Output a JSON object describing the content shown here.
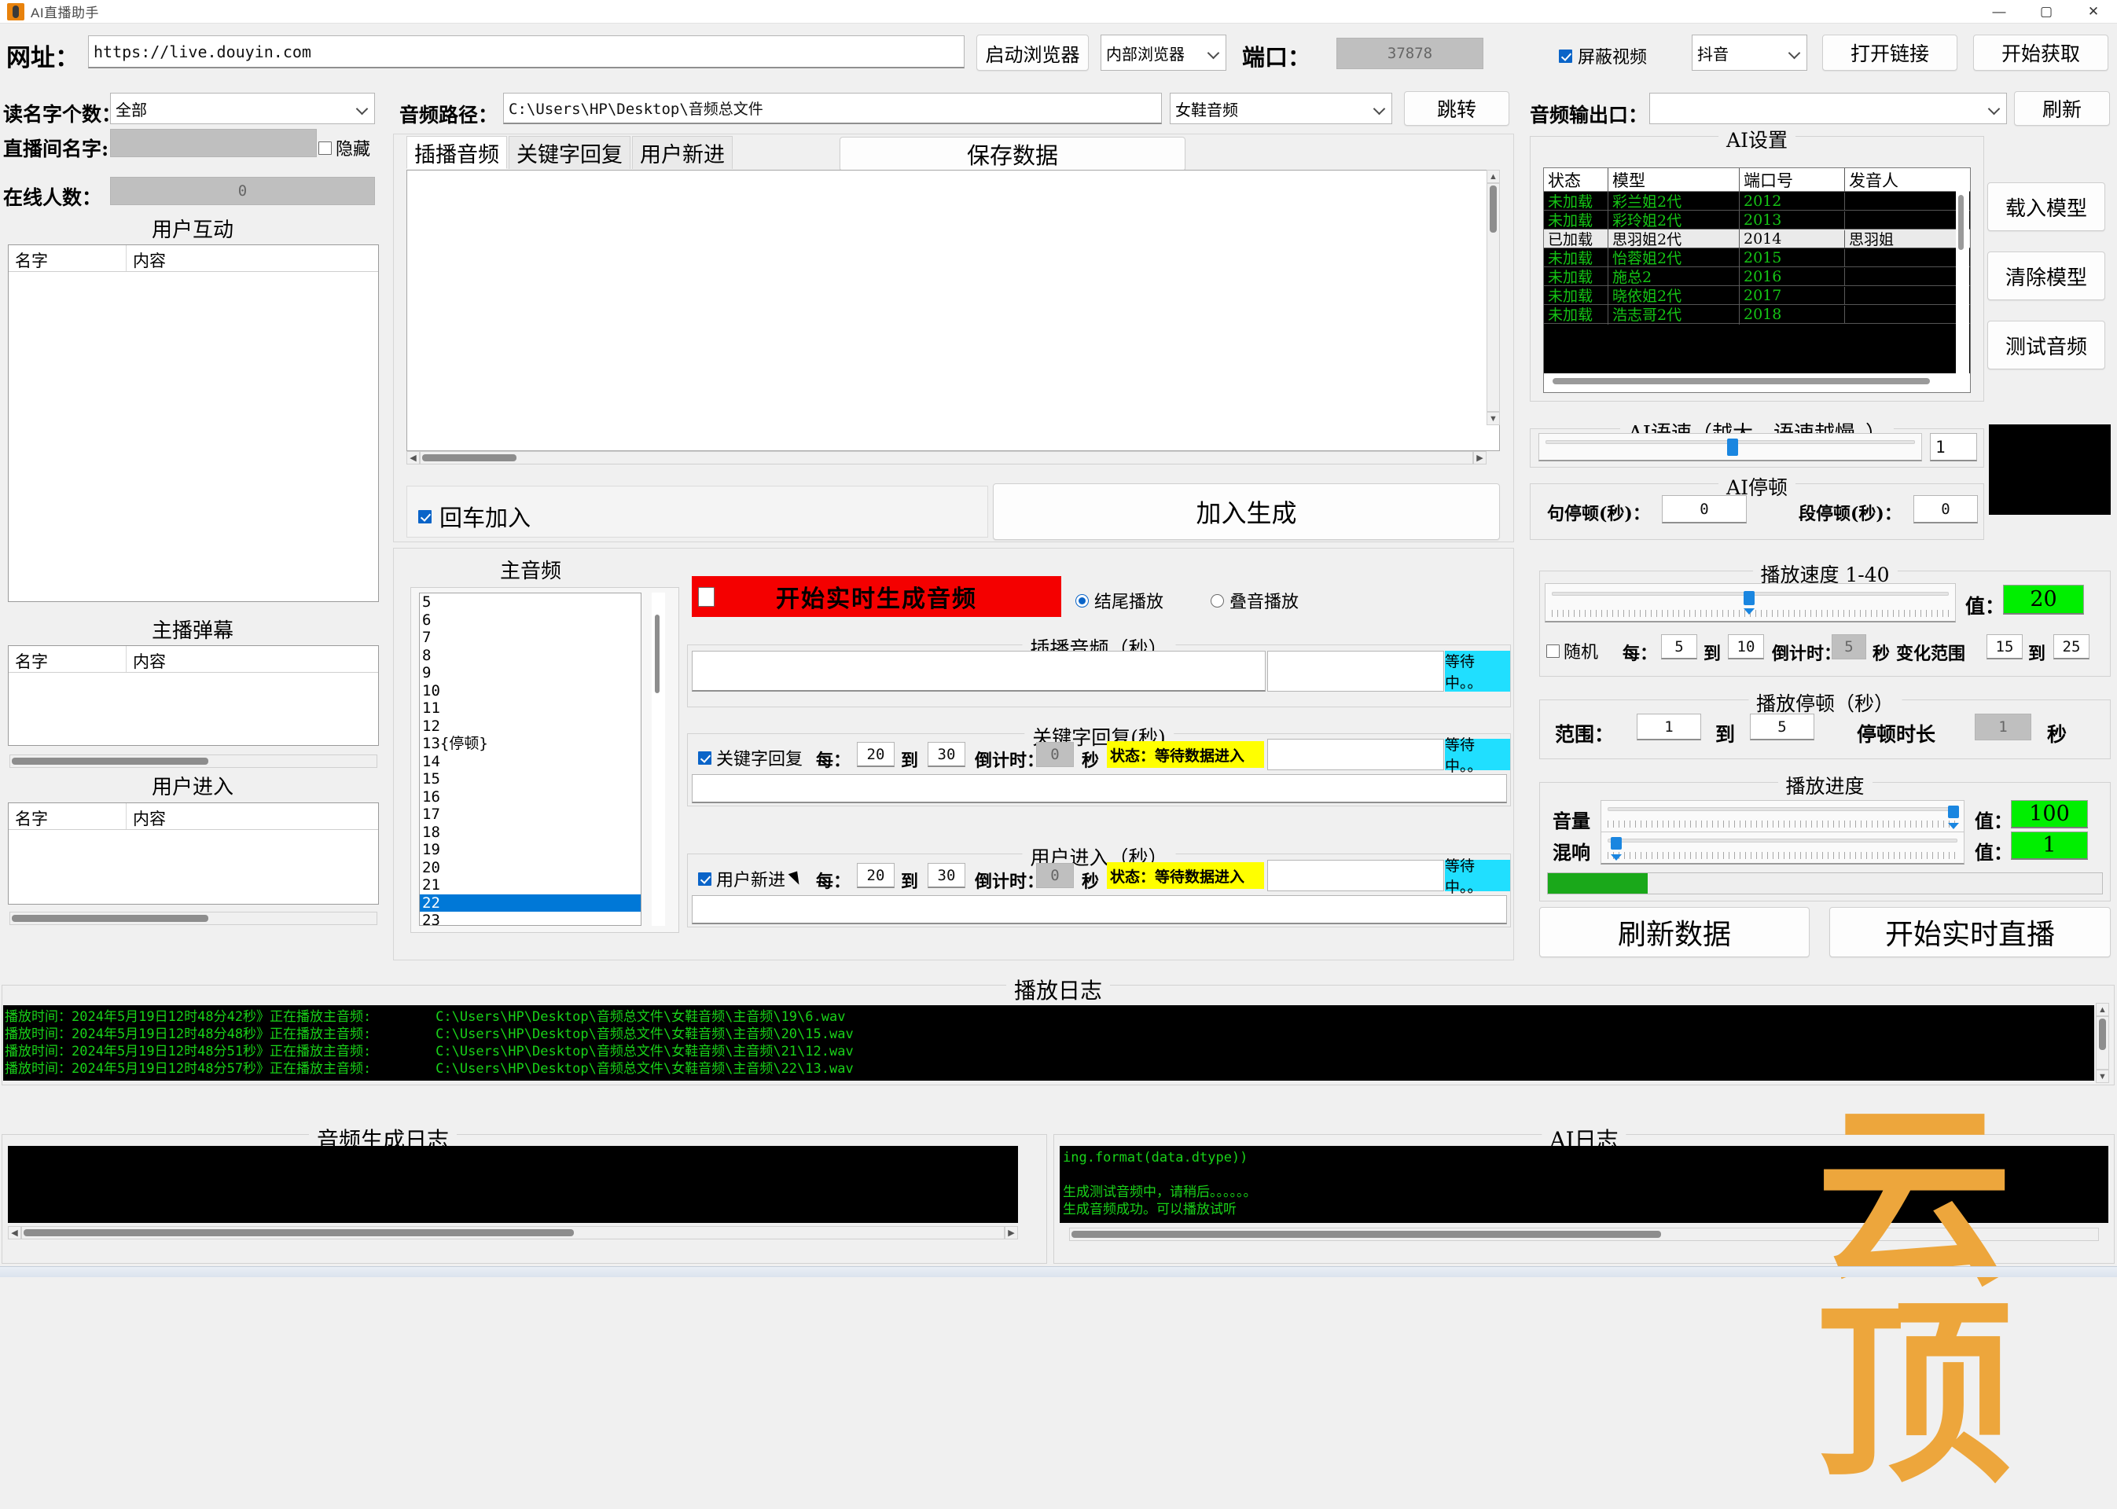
{
  "window": {
    "title": "AI直播助手",
    "minimize": "—",
    "maximize": "▢",
    "close": "✕"
  },
  "url_row": {
    "label": "网址：",
    "value": "https://live.douyin.com",
    "start_browser_button": "启动浏览器",
    "browser_select": "内部浏览器",
    "port_label": "端口：",
    "port_value": "37878",
    "block_video_label": "屏蔽视频",
    "block_video_checked": true,
    "platform_select": "抖音",
    "open_link_button": "打开链接",
    "start_fetch_button": "开始获取"
  },
  "left_panel": {
    "read_name_count_label": "读名字个数：",
    "read_name_count_value": "全部",
    "room_name_label": "直播间名字:",
    "room_name_value": "",
    "hide_label": "隐藏",
    "hide_checked": false,
    "online_count_label": "在线人数：",
    "online_count_value": "0",
    "sections": [
      {
        "title": "用户互动",
        "col_name": "名字",
        "col_content": "内容",
        "rows": []
      },
      {
        "title": "主播弹幕",
        "col_name": "名字",
        "col_content": "内容",
        "rows": []
      },
      {
        "title": "用户进入",
        "col_name": "名字",
        "col_content": "内容",
        "rows": []
      }
    ]
  },
  "audio_path_row": {
    "label": "音频路径：",
    "value": "C:\\Users\\HP\\Desktop\\音频总文件",
    "folder_select": "女鞋音频",
    "jump_button": "跳转",
    "output_label": "音频输出口：",
    "output_value": "",
    "refresh_button": "刷新"
  },
  "editor": {
    "tabs": [
      {
        "label": "插播音频",
        "active": true
      },
      {
        "label": "关键字回复",
        "active": false
      },
      {
        "label": "用户新进",
        "active": false
      }
    ],
    "save_button": "保存数据",
    "text": "",
    "enter_join_label": "回车加入",
    "enter_join_checked": true,
    "join_generate_button": "加入生成"
  },
  "ai_settings": {
    "caption": "AI设置",
    "columns": [
      "状态",
      "模型",
      "端口号",
      "发音人"
    ],
    "rows": [
      {
        "status": "未加载",
        "model": "彩兰姐2代",
        "port": "2012",
        "speaker": "",
        "loaded": false
      },
      {
        "status": "未加载",
        "model": "彩玲姐2代",
        "port": "2013",
        "speaker": "",
        "loaded": false
      },
      {
        "status": "已加载",
        "model": "思羽姐2代",
        "port": "2014",
        "speaker": "思羽姐",
        "loaded": true
      },
      {
        "status": "未加载",
        "model": "怡蓉姐2代",
        "port": "2015",
        "speaker": "",
        "loaded": false
      },
      {
        "status": "未加载",
        "model": "施总2",
        "port": "2016",
        "speaker": "",
        "loaded": false
      },
      {
        "status": "未加载",
        "model": "晓依姐2代",
        "port": "2017",
        "speaker": "",
        "loaded": false
      },
      {
        "status": "未加载",
        "model": "浩志哥2代",
        "port": "2018",
        "speaker": "",
        "loaded": false
      }
    ],
    "load_model_button": "载入模型",
    "clear_model_button": "清除模型",
    "test_audio_button": "测试音频"
  },
  "ai_speed": {
    "caption": "AI语速（越大，语速越慢。）",
    "value": "1",
    "slider_percent": 50
  },
  "ai_pause": {
    "caption": "AI停顿",
    "sentence_label": "句停顿(秒)：",
    "sentence_value": "0",
    "paragraph_label": "段停顿(秒)：",
    "paragraph_value": "0"
  },
  "main_audio": {
    "title": "主音频",
    "items": [
      "5",
      "6",
      "7",
      "8",
      "9",
      "10",
      "11",
      "12",
      "13{停顿}",
      "14",
      "15",
      "16",
      "17",
      "18",
      "19",
      "20",
      "21",
      "22",
      "23"
    ],
    "selected": "22"
  },
  "realtime": {
    "start_realtime_audio_label": "开始实时生成音频",
    "start_realtime_audio_checked": false,
    "play_mode_end_label": "结尾播放",
    "play_mode_overlay_label": "叠音播放",
    "play_mode_selected": "结尾播放"
  },
  "insert_audio": {
    "caption": "插播音频（秒）",
    "input_value": "",
    "status_badge": "等待中。。"
  },
  "keyword_reply": {
    "caption": "关键字回复(秒)",
    "enabled_label": "关键字回复",
    "enabled": true,
    "every_label": "每：",
    "from": "20",
    "to_label": "到",
    "to": "30",
    "countdown_label": "倒计时：",
    "countdown": "0",
    "seconds_label": "秒",
    "status_text": "状态：等待数据进入",
    "status_badge": "等待中。。",
    "input_value": ""
  },
  "user_enter": {
    "caption": "用户进入（秒）",
    "enabled_label": "用户新进",
    "enabled": true,
    "every_label": "每：",
    "from": "20",
    "to_label": "到",
    "to": "30",
    "countdown_label": "倒计时：",
    "countdown": "0",
    "seconds_label": "秒",
    "status_text": "状态：等待数据进入",
    "status_badge": "等待中。。",
    "input_value": ""
  },
  "play_speed": {
    "caption": "播放速度  1-40",
    "value_label": "值：",
    "value": "20",
    "slider_percent": 49,
    "random_label": "随机",
    "random_checked": false,
    "every_label": "每：",
    "from": "5",
    "to_label": "到",
    "to": "10",
    "countdown_label": "倒计时：",
    "countdown": "5",
    "seconds_label": "秒",
    "range_label": "变化范围",
    "range_from": "15",
    "range_to_label": "到",
    "range_to": "25"
  },
  "play_pause": {
    "caption": "播放停顿（秒）",
    "range_label": "范围：",
    "from": "1",
    "to_label": "到",
    "to": "5",
    "duration_label": "停顿时长",
    "duration": "1",
    "seconds_label": "秒"
  },
  "play_progress": {
    "caption": "播放进度",
    "volume_label": "音量",
    "volume_value_label": "值：",
    "volume_value": "100",
    "volume_percent": 99,
    "reverb_label": "混响",
    "reverb_value_label": "值：",
    "reverb_value": "1",
    "reverb_percent": 1,
    "progress_percent": 18,
    "refresh_data_button": "刷新数据",
    "start_live_button": "开始实时直播"
  },
  "play_log": {
    "title": "播放日志",
    "lines": [
      "播放时间：2024年5月19日12时48分42秒》正在播放主音频:        C:\\Users\\HP\\Desktop\\音频总文件\\女鞋音频\\主音频\\19\\6.wav",
      "播放时间：2024年5月19日12时48分48秒》正在播放主音频:        C:\\Users\\HP\\Desktop\\音频总文件\\女鞋音频\\主音频\\20\\15.wav",
      "播放时间：2024年5月19日12时48分51秒》正在播放主音频:        C:\\Users\\HP\\Desktop\\音频总文件\\女鞋音频\\主音频\\21\\12.wav",
      "播放时间：2024年5月19日12时48分57秒》正在播放主音频:        C:\\Users\\HP\\Desktop\\音频总文件\\女鞋音频\\主音频\\22\\13.wav"
    ]
  },
  "audio_gen_log": {
    "title": "音频生成日志",
    "lines": []
  },
  "ai_log": {
    "title": "AI日志",
    "lines": [
      "ing.format(data.dtype))",
      "",
      "生成测试音频中，请稍后。。。。。。",
      "生成音频成功。可以播放试听"
    ]
  },
  "watermark": {
    "text": "云顶"
  }
}
